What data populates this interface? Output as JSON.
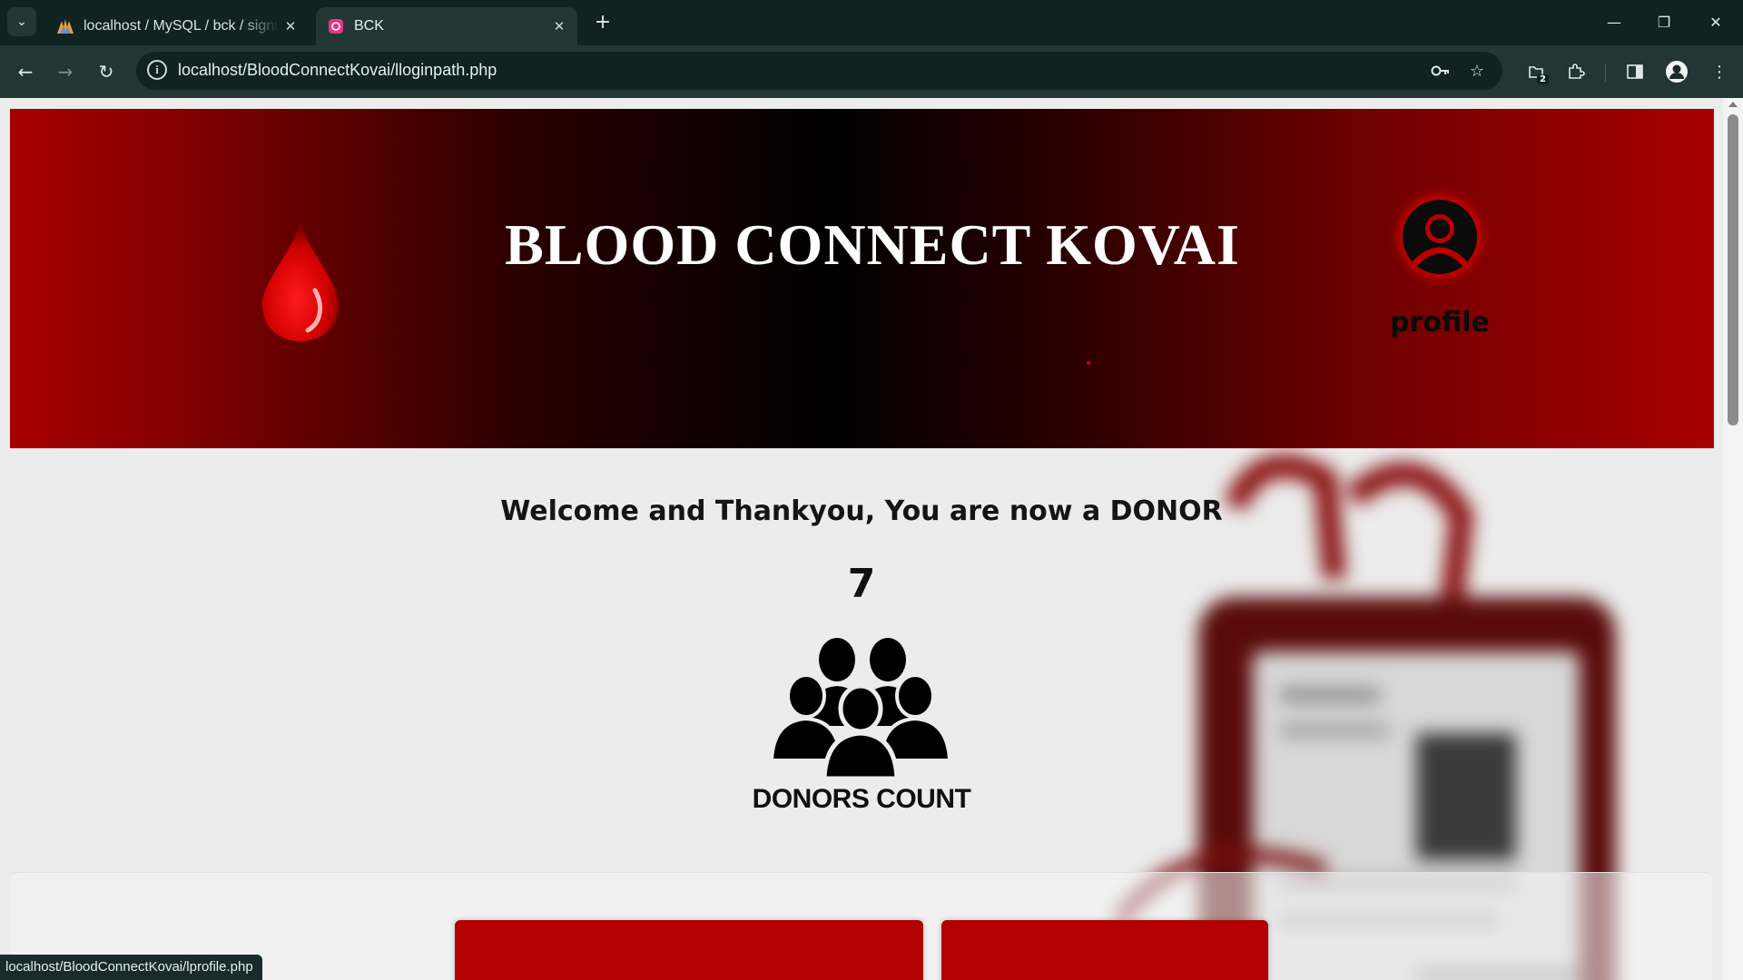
{
  "browser": {
    "tabs": [
      {
        "title": "localhost / MySQL / bck / signup",
        "favicon": "phpmyadmin-icon",
        "active": false
      },
      {
        "title": "BCK",
        "favicon": "bck-favicon",
        "active": true
      }
    ],
    "url": "localhost/BloodConnectKovai/lloginpath.php",
    "extension_badge": "2",
    "status_url": "localhost/BloodConnectKovai/lprofile.php"
  },
  "page": {
    "site_title": "BLOOD CONNECT KOVAI",
    "profile_label": "profile",
    "welcome_text": "Welcome and Thankyou, You are now a DONOR",
    "donor_count": "7",
    "donor_count_label": "DONORS COUNT"
  },
  "colors": {
    "banner_red": "#a80000",
    "card_red": "#b30000",
    "chrome_dark": "#112222"
  }
}
